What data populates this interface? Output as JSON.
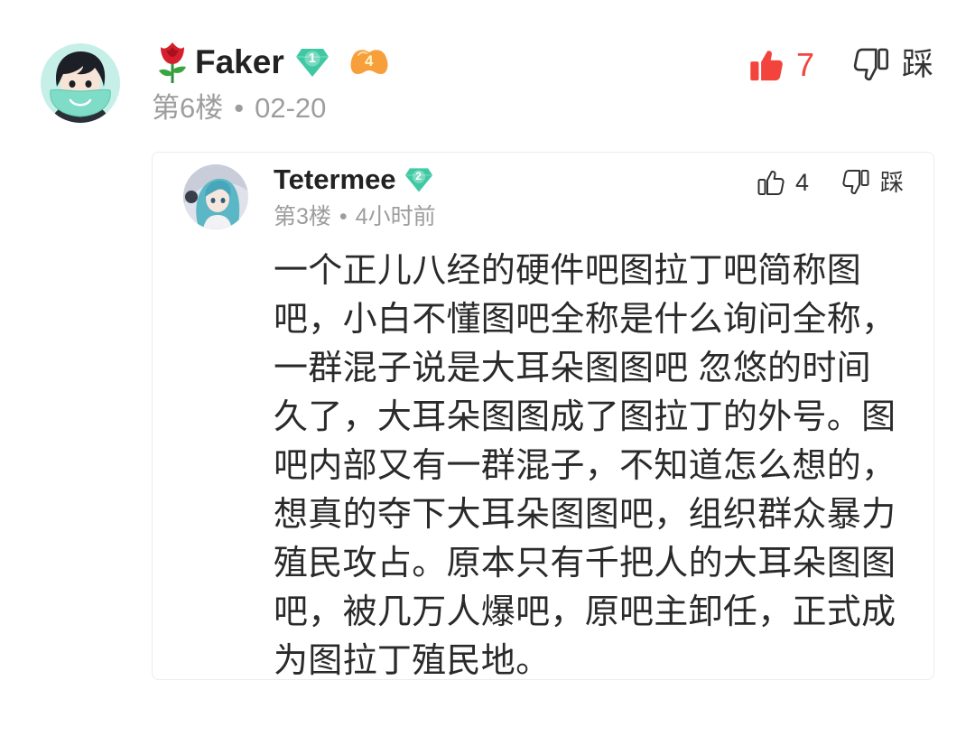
{
  "comment": {
    "author": "Faker",
    "level_badge": "1",
    "fan_badge": "4",
    "floor": "第6楼",
    "separator": "•",
    "date": "02-20",
    "like_count": "7",
    "dislike_label": "踩"
  },
  "reply": {
    "author": "Tetermee",
    "level_badge": "2",
    "floor": "第3楼",
    "separator": "•",
    "time": "4小时前",
    "like_count": "4",
    "dislike_label": "踩",
    "body_lines": [
      "一个正儿八经的硬件吧图拉丁吧简称图",
      "吧，小白不懂图吧全称是什么询问全称，",
      "一群混子说是大耳朵图图吧 忽悠的时间",
      "久了，大耳朵图图成了图拉丁的外号。图",
      "吧内部又有一群混子，不知道怎么想的，",
      "想真的夺下大耳朵图图吧，组织群众暴力",
      "殖民攻占。原本只有千把人的大耳朵图图",
      "吧，被几万人爆吧，原吧主卸任，正式成",
      "为图拉丁殖民地。"
    ]
  },
  "icons": {
    "rose": "rose-icon",
    "level_badge": "diamond-badge-icon",
    "fan_badge": "fan-level-badge-icon",
    "like": "thumbs-up-icon",
    "dislike": "thumbs-down-icon"
  },
  "colors": {
    "like_red": "#f2443d",
    "badge_green": "#3fc9a3",
    "fan_orange": "#f7a03b",
    "meta_gray": "#9d9d9d",
    "text": "#262626",
    "card_border": "#ececec"
  }
}
